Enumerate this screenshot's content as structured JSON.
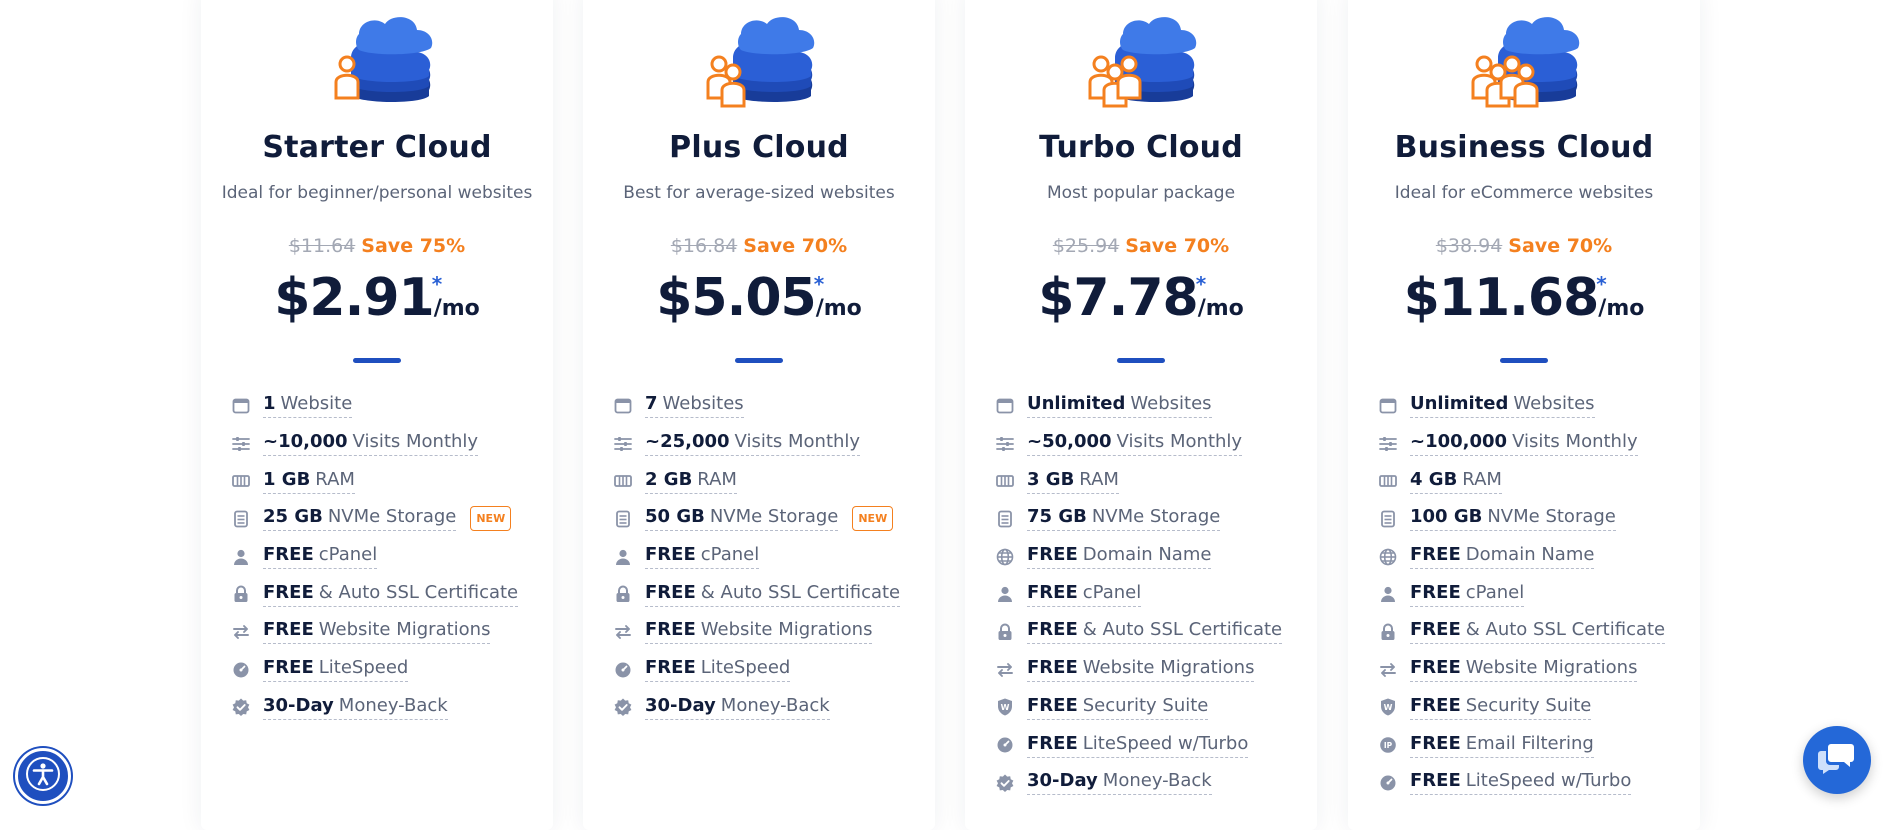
{
  "colors": {
    "accent": "#1f4fbf",
    "orange": "#f4801f",
    "text": "#101c3a",
    "muted": "#5b6478"
  },
  "plans": [
    {
      "name": "Starter Cloud",
      "description": "Ideal for beginner/personal websites",
      "old_price": "$11.64",
      "save": "Save 75%",
      "price": "$2.91",
      "asterisk": "*",
      "per": "/mo",
      "people": 1,
      "features": [
        {
          "icon": "browser-window-icon",
          "value": "1",
          "label": "Website"
        },
        {
          "icon": "sliders-icon",
          "value": "~10,000",
          "label": "Visits Monthly"
        },
        {
          "icon": "ram-icon",
          "value": "1 GB",
          "label": "RAM"
        },
        {
          "icon": "storage-icon",
          "value": "25 GB",
          "label": "NVMe Storage",
          "badge": "NEW"
        },
        {
          "icon": "user-icon",
          "value": "FREE",
          "label": "cPanel"
        },
        {
          "icon": "lock-icon",
          "value": "FREE",
          "label": "& Auto SSL Certificate"
        },
        {
          "icon": "arrows-exchange-icon",
          "value": "FREE",
          "label": "Website Migrations"
        },
        {
          "icon": "speedometer-icon",
          "value": "FREE",
          "label": "LiteSpeed"
        },
        {
          "icon": "verified-badge-icon",
          "value": "30-Day",
          "label": "Money-Back"
        }
      ]
    },
    {
      "name": "Plus Cloud",
      "description": "Best for average-sized websites",
      "old_price": "$16.84",
      "save": "Save 70%",
      "price": "$5.05",
      "asterisk": "*",
      "per": "/mo",
      "people": 2,
      "features": [
        {
          "icon": "browser-window-icon",
          "value": "7",
          "label": "Websites"
        },
        {
          "icon": "sliders-icon",
          "value": "~25,000",
          "label": "Visits Monthly"
        },
        {
          "icon": "ram-icon",
          "value": "2 GB",
          "label": "RAM"
        },
        {
          "icon": "storage-icon",
          "value": "50 GB",
          "label": "NVMe Storage",
          "badge": "NEW"
        },
        {
          "icon": "user-icon",
          "value": "FREE",
          "label": "cPanel"
        },
        {
          "icon": "lock-icon",
          "value": "FREE",
          "label": "& Auto SSL Certificate"
        },
        {
          "icon": "arrows-exchange-icon",
          "value": "FREE",
          "label": "Website Migrations"
        },
        {
          "icon": "speedometer-icon",
          "value": "FREE",
          "label": "LiteSpeed"
        },
        {
          "icon": "verified-badge-icon",
          "value": "30-Day",
          "label": "Money-Back"
        }
      ]
    },
    {
      "name": "Turbo Cloud",
      "description": "Most popular package",
      "old_price": "$25.94",
      "save": "Save 70%",
      "price": "$7.78",
      "asterisk": "*",
      "per": "/mo",
      "people": 3,
      "features": [
        {
          "icon": "browser-window-icon",
          "value": "Unlimited",
          "label": "Websites"
        },
        {
          "icon": "sliders-icon",
          "value": "~50,000",
          "label": "Visits Monthly"
        },
        {
          "icon": "ram-icon",
          "value": "3 GB",
          "label": "RAM"
        },
        {
          "icon": "storage-icon",
          "value": "75 GB",
          "label": "NVMe Storage"
        },
        {
          "icon": "globe-icon",
          "value": "FREE",
          "label": "Domain Name"
        },
        {
          "icon": "user-icon",
          "value": "FREE",
          "label": "cPanel"
        },
        {
          "icon": "lock-icon",
          "value": "FREE",
          "label": "& Auto SSL Certificate"
        },
        {
          "icon": "arrows-exchange-icon",
          "value": "FREE",
          "label": "Website Migrations"
        },
        {
          "icon": "shield-icon",
          "value": "FREE",
          "label": "Security Suite"
        },
        {
          "icon": "speedometer-icon",
          "value": "FREE",
          "label": "LiteSpeed w/Turbo"
        },
        {
          "icon": "verified-badge-icon",
          "value": "30-Day",
          "label": "Money-Back"
        }
      ]
    },
    {
      "name": "Business Cloud",
      "description": "Ideal for eCommerce websites",
      "old_price": "$38.94",
      "save": "Save 70%",
      "price": "$11.68",
      "asterisk": "*",
      "per": "/mo",
      "people": 4,
      "features": [
        {
          "icon": "browser-window-icon",
          "value": "Unlimited",
          "label": "Websites"
        },
        {
          "icon": "sliders-icon",
          "value": "~100,000",
          "label": "Visits Monthly"
        },
        {
          "icon": "ram-icon",
          "value": "4 GB",
          "label": "RAM"
        },
        {
          "icon": "storage-icon",
          "value": "100 GB",
          "label": "NVMe Storage"
        },
        {
          "icon": "globe-icon",
          "value": "FREE",
          "label": "Domain Name"
        },
        {
          "icon": "user-icon",
          "value": "FREE",
          "label": "cPanel"
        },
        {
          "icon": "lock-icon",
          "value": "FREE",
          "label": "& Auto SSL Certificate"
        },
        {
          "icon": "arrows-exchange-icon",
          "value": "FREE",
          "label": "Website Migrations"
        },
        {
          "icon": "shield-icon",
          "value": "FREE",
          "label": "Security Suite"
        },
        {
          "icon": "email-filter-icon",
          "value": "FREE",
          "label": "Email Filtering"
        },
        {
          "icon": "speedometer-icon",
          "value": "FREE",
          "label": "LiteSpeed w/Turbo"
        }
      ]
    }
  ],
  "widgets": {
    "accessibility_icon": "accessibility-icon",
    "chat_icon": "chat-icon"
  }
}
